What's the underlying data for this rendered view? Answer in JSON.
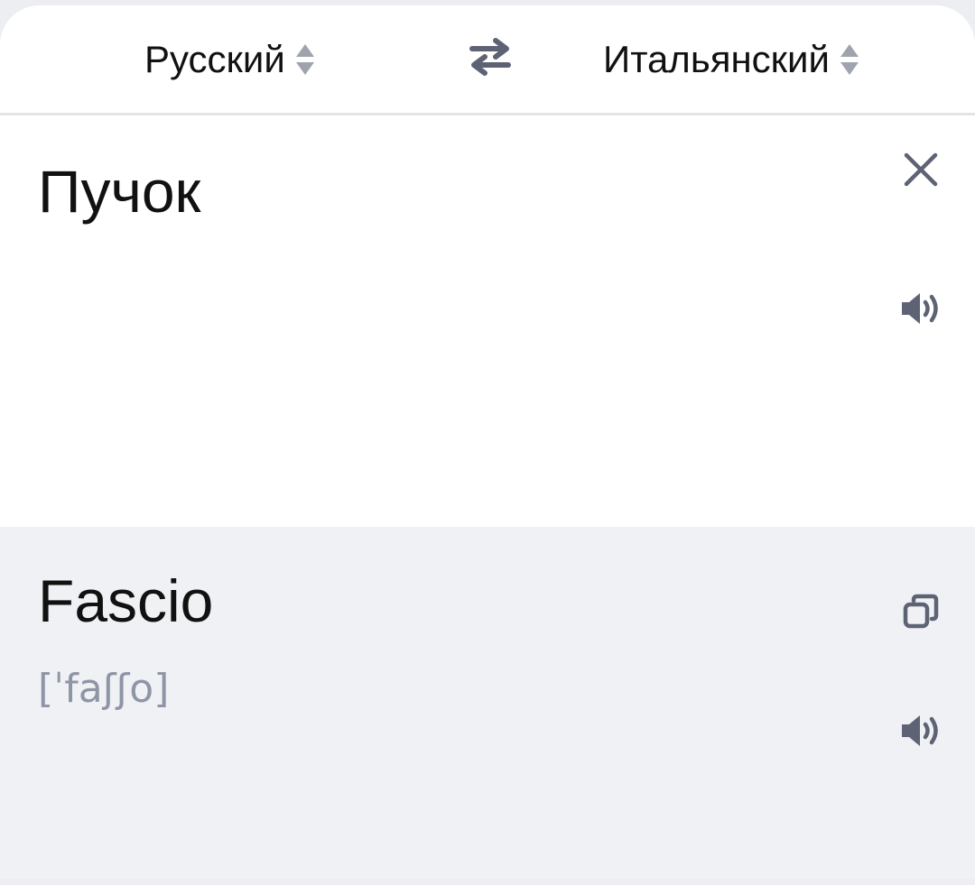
{
  "languages": {
    "source_label": "Русский",
    "target_label": "Итальянский"
  },
  "icons": {
    "sort": "sort-arrows-icon",
    "swap": "swap-arrows-icon",
    "clear": "close-icon",
    "speak": "speaker-icon",
    "copy": "copy-icon"
  },
  "source": {
    "text": "Пучок"
  },
  "result": {
    "text": "Fascio",
    "transcription": "[ˈfaʃʃo]"
  },
  "colors": {
    "icon": "#5d6374",
    "transcription": "#8e95a5",
    "result_background": "#f0f1f5",
    "divider": "#e2e4e8"
  }
}
